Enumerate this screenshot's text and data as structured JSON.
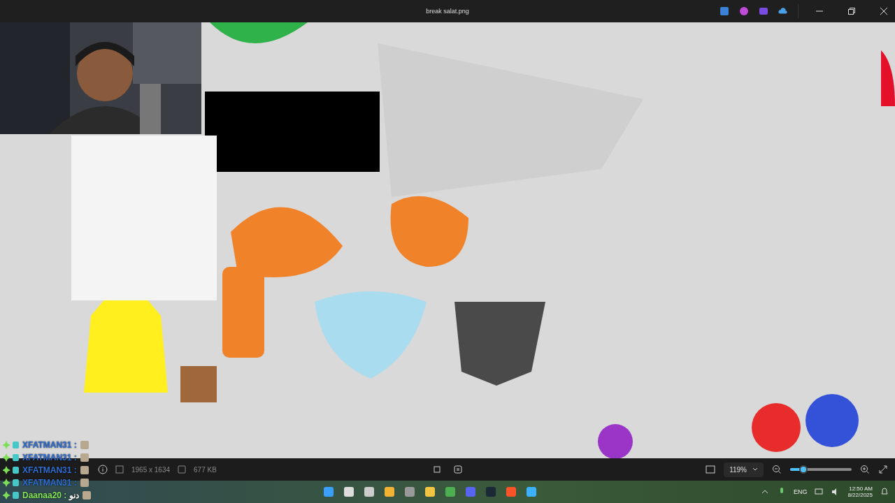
{
  "window": {
    "title": "break salat.png"
  },
  "toolbar": {
    "dimensions": "1965 x 1634",
    "file_size": "677 KB",
    "zoom": {
      "value": "119%",
      "level": 0.22
    }
  },
  "chat": [
    {
      "user": "XFATMAN31 :",
      "color": "#2f6fd6"
    },
    {
      "user": "XFATMAN31 :",
      "color": "#2f6fd6"
    },
    {
      "user": "XFATMAN31 :",
      "color": "#2f6fd6"
    },
    {
      "user": "XFATMAN31 :",
      "color": "#2f6fd6"
    },
    {
      "user": "Daanaa20 :",
      "color": "#86e85a",
      "message": "دنو"
    }
  ],
  "taskbar": {
    "language": "ENG",
    "time": "12:50 AM",
    "date": "8/22/2025"
  }
}
